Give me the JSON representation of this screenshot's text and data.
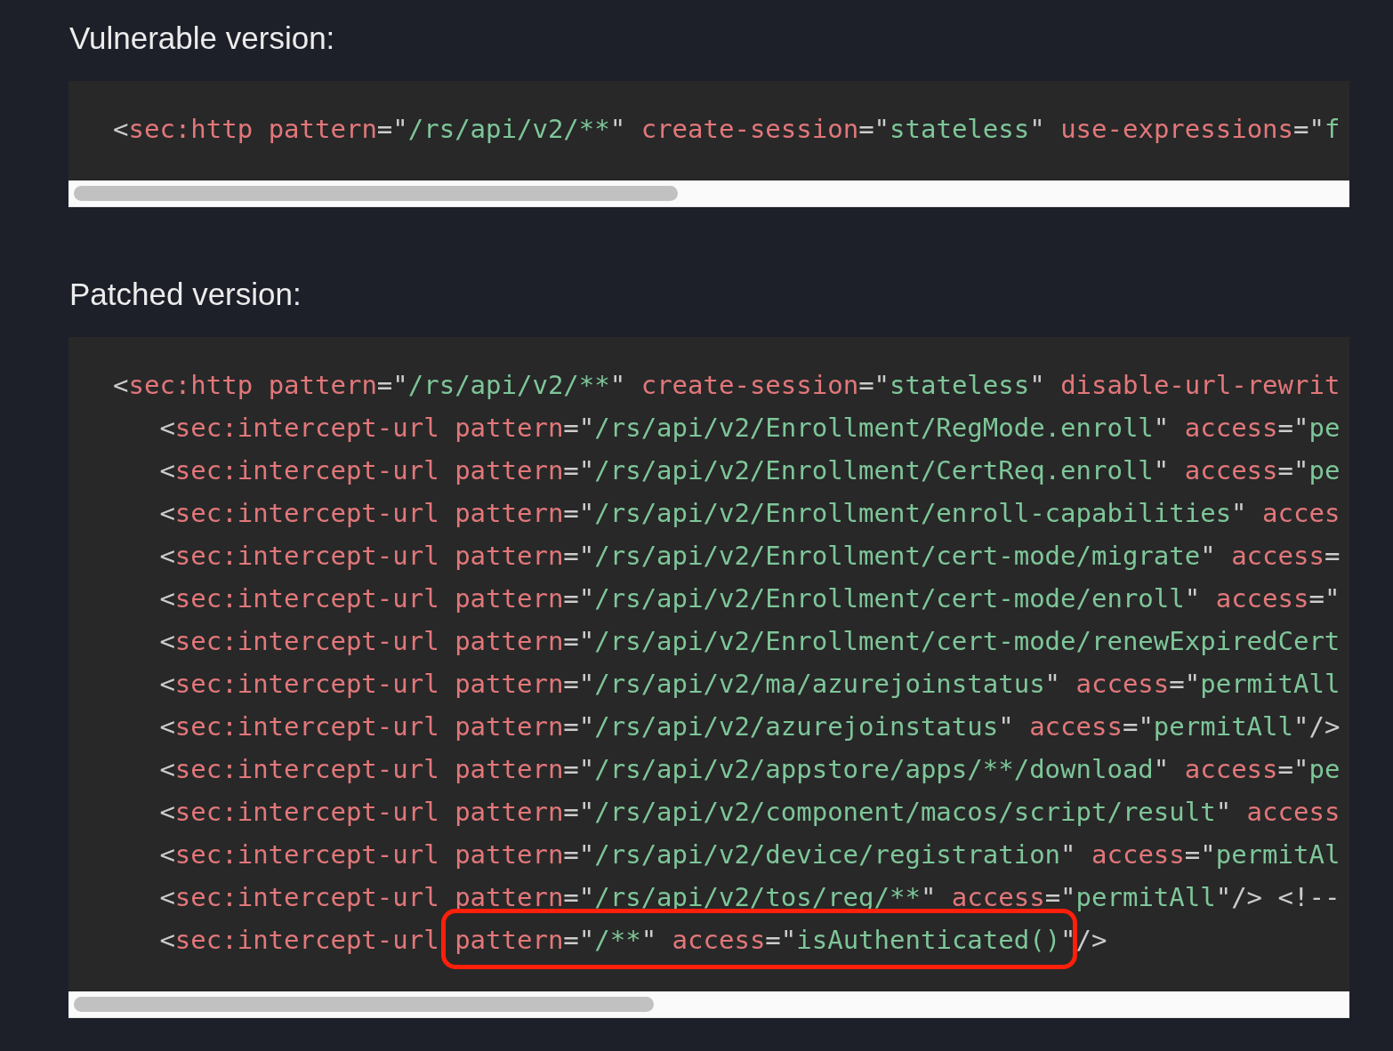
{
  "sections": [
    {
      "heading": "Vulnerable version:",
      "code": [
        {
          "segments": [
            {
              "text": "<sec:http pattern=\"/rs/api/v2/**\" create-session=\"stateless\" use-expressions=\"f",
              "highlighted": false
            }
          ]
        }
      ]
    },
    {
      "heading": "Patched version:",
      "code": [
        {
          "segments": [
            {
              "text": "<sec:http pattern=\"/rs/api/v2/**\" create-session=\"stateless\" disable-url-rewrit",
              "highlighted": false
            }
          ],
          "children": [
            {
              "segments": [
                {
                  "text": "<sec:intercept-url pattern=\"/rs/api/v2/Enrollment/RegMode.enroll\" access=\"pe",
                  "highlighted": false
                }
              ]
            },
            {
              "segments": [
                {
                  "text": "<sec:intercept-url pattern=\"/rs/api/v2/Enrollment/CertReq.enroll\" access=\"pe",
                  "highlighted": false
                }
              ]
            },
            {
              "segments": [
                {
                  "text": "<sec:intercept-url pattern=\"/rs/api/v2/Enrollment/enroll-capabilities\" acces",
                  "highlighted": false
                }
              ]
            },
            {
              "segments": [
                {
                  "text": "<sec:intercept-url pattern=\"/rs/api/v2/Enrollment/cert-mode/migrate\" access=",
                  "highlighted": false
                }
              ]
            },
            {
              "segments": [
                {
                  "text": "<sec:intercept-url pattern=\"/rs/api/v2/Enrollment/cert-mode/enroll\" access=\"",
                  "highlighted": false
                }
              ]
            },
            {
              "segments": [
                {
                  "text": "<sec:intercept-url pattern=\"/rs/api/v2/Enrollment/cert-mode/renewExpiredCert",
                  "highlighted": false
                }
              ]
            },
            {
              "segments": [
                {
                  "text": "<sec:intercept-url pattern=\"/rs/api/v2/ma/azurejoinstatus\" access=\"permitAll",
                  "highlighted": false
                }
              ]
            },
            {
              "segments": [
                {
                  "text": "<sec:intercept-url pattern=\"/rs/api/v2/azurejoinstatus\" access=\"permitAll\"/>",
                  "highlighted": false
                }
              ]
            },
            {
              "segments": [
                {
                  "text": "<sec:intercept-url pattern=\"/rs/api/v2/appstore/apps/**/download\" access=\"pe",
                  "highlighted": false
                }
              ]
            },
            {
              "segments": [
                {
                  "text": "<sec:intercept-url pattern=\"/rs/api/v2/component/macos/script/result\" access",
                  "highlighted": false
                }
              ]
            },
            {
              "segments": [
                {
                  "text": "<sec:intercept-url pattern=\"/rs/api/v2/device/registration\" access=\"permitAl",
                  "highlighted": false
                }
              ]
            },
            {
              "segments": [
                {
                  "text": "<sec:intercept-url pattern=\"/rs/api/v2/tos/reg/**\" access=\"permitAll\"/> <!--",
                  "highlighted": false
                }
              ]
            },
            {
              "segments": [
                {
                  "text": "<sec:intercept-url ",
                  "highlighted": false
                },
                {
                  "text": "pattern=\"/**\" access=\"isAuthenticated()\"",
                  "highlighted": true
                },
                {
                  "text": "/>",
                  "highlighted": false
                }
              ]
            }
          ]
        }
      ]
    }
  ]
}
